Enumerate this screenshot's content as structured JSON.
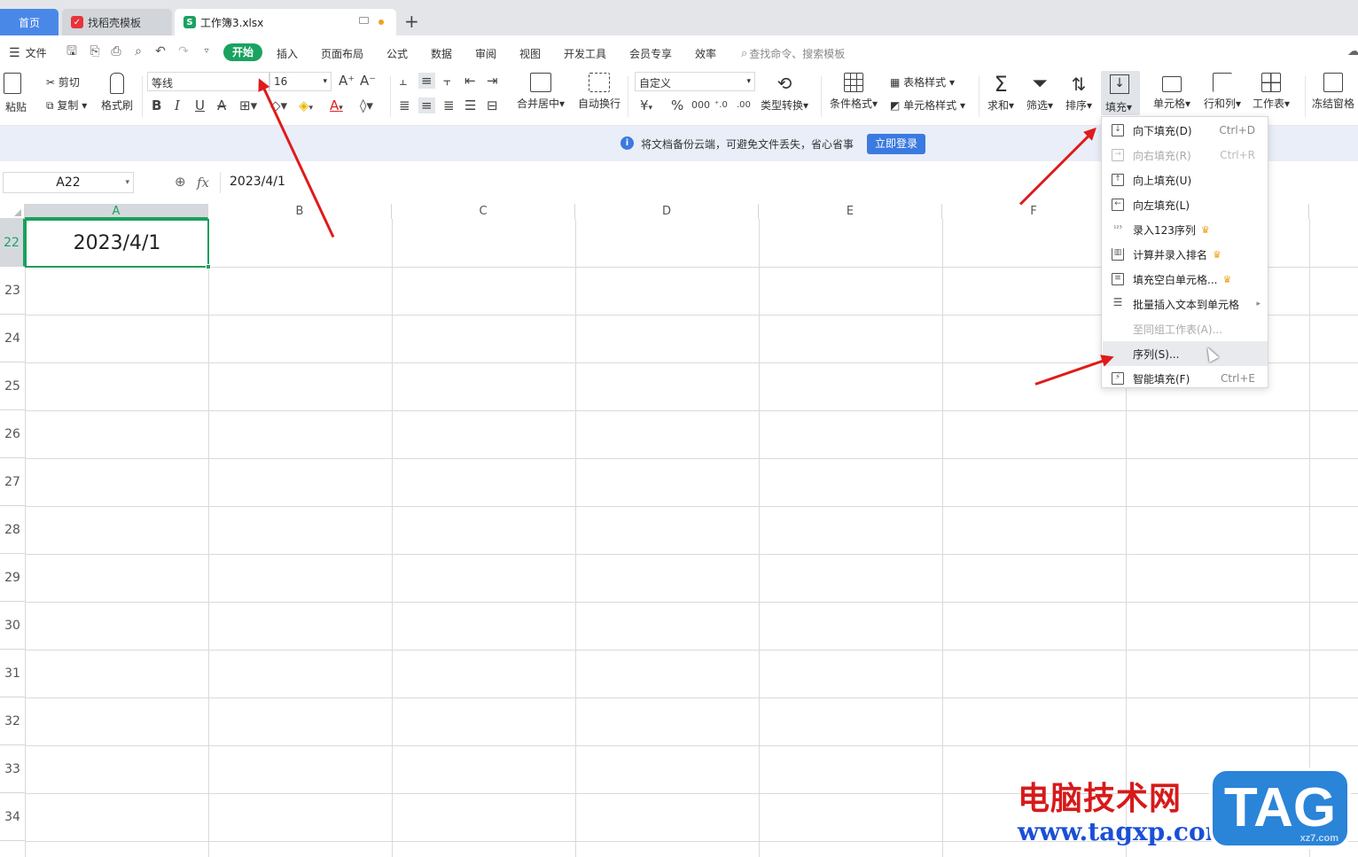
{
  "tabs": {
    "home": "首页",
    "template": "找稻壳模板",
    "workbook": "工作簿3.xlsx",
    "new_tab": "+"
  },
  "menu": {
    "file": "文件",
    "items": [
      "开始",
      "插入",
      "页面布局",
      "公式",
      "数据",
      "审阅",
      "视图",
      "开发工具",
      "会员专享",
      "效率"
    ],
    "search_placeholder": "查找命令、搜索模板"
  },
  "ribbon": {
    "paste": "粘贴",
    "cut": "剪切",
    "copy": "复制",
    "format_painter": "格式刷",
    "font_name": "等线",
    "font_size": "16",
    "merge_center": "合并居中",
    "wrap_text": "自动换行",
    "number_format": "自定义",
    "type_convert": "类型转换",
    "cond_format": "条件格式",
    "table_style": "表格样式",
    "cell_style": "单元格样式",
    "sum": "求和",
    "filter": "筛选",
    "sort": "排序",
    "fill": "填充",
    "cell": "单元格",
    "row_col": "行和列",
    "sheet": "工作表",
    "freeze": "冻结窗格"
  },
  "notice": {
    "text": "将文档备份云端，可避免文件丢失，省心省事",
    "login_button": "立即登录"
  },
  "formula_bar": {
    "cell_ref": "A22",
    "fx": "fx",
    "value": "2023/4/1"
  },
  "grid": {
    "columns": [
      "A",
      "B",
      "C",
      "D",
      "E",
      "F"
    ],
    "rows": [
      "22",
      "23",
      "24",
      "25",
      "26",
      "27",
      "28",
      "29",
      "30",
      "31",
      "32",
      "33",
      "34"
    ],
    "cell_a22": "2023/4/1"
  },
  "fill_menu": {
    "items": [
      {
        "label": "向下填充(D)",
        "shortcut": "Ctrl+D",
        "icon": "fill-down-icon",
        "disabled": false
      },
      {
        "label": "向右填充(R)",
        "shortcut": "Ctrl+R",
        "icon": "fill-right-icon",
        "disabled": true
      },
      {
        "label": "向上填充(U)",
        "shortcut": "",
        "icon": "fill-up-icon",
        "disabled": false
      },
      {
        "label": "向左填充(L)",
        "shortcut": "",
        "icon": "fill-left-icon",
        "disabled": false
      },
      {
        "label": "录入123序列",
        "shortcut": "",
        "icon": "sequence-123-icon",
        "disabled": false,
        "premium": true
      },
      {
        "label": "计算并录入排名",
        "shortcut": "",
        "icon": "rank-icon",
        "disabled": false,
        "premium": true
      },
      {
        "label": "填充空白单元格...",
        "shortcut": "",
        "icon": "blank-cell-icon",
        "disabled": false,
        "premium": true
      },
      {
        "label": "批量插入文本到单元格",
        "shortcut": "",
        "icon": "batch-insert-icon",
        "disabled": false,
        "submenu": true
      },
      {
        "label": "至同组工作表(A)...",
        "shortcut": "",
        "icon": "",
        "disabled": true
      },
      {
        "label": "序列(S)...",
        "shortcut": "",
        "icon": "",
        "disabled": false
      },
      {
        "label": "智能填充(F)",
        "shortcut": "Ctrl+E",
        "icon": "smart-fill-icon",
        "disabled": false
      }
    ]
  },
  "watermark": {
    "site_name": "电脑技术网",
    "url": "www.tagxp.com",
    "tag": "TAG",
    "small": "xz7.com"
  },
  "colors": {
    "accent_green": "#1aa260",
    "arrow_red": "#e01b1b",
    "selection_green": "#1e9e5a",
    "login_blue": "#3b7ae0"
  }
}
